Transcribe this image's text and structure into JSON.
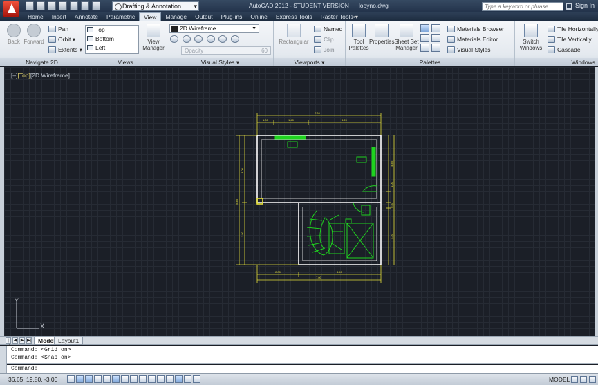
{
  "titlebar": {
    "app_title": "AutoCAD 2012 - STUDENT VERSION",
    "file_name": "looyno.dwg",
    "workspace": "Drafting & Annotation",
    "search_placeholder": "Type a keyword or phrase",
    "sign_in": "Sign In"
  },
  "ribbon_tabs": [
    "Home",
    "Insert",
    "Annotate",
    "Parametric",
    "View",
    "Manage",
    "Output",
    "Plug-ins",
    "Online",
    "Express Tools",
    "Raster Tools"
  ],
  "active_tab": "View",
  "ribbon": {
    "navigate": {
      "label": "Navigate 2D",
      "back": "Back",
      "forward": "Forward",
      "pan": "Pan",
      "orbit": "Orbit",
      "extents": "Extents"
    },
    "views": {
      "label": "Views",
      "items": [
        "Top",
        "Bottom",
        "Left"
      ],
      "view_manager": "View Manager"
    },
    "visual_styles": {
      "label": "Visual Styles",
      "current": "2D Wireframe",
      "opacity_label": "Opacity",
      "opacity_value": "60"
    },
    "viewports": {
      "label": "Viewports",
      "rectangular": "Rectangular",
      "named": "Named",
      "clip": "Clip",
      "join": "Join"
    },
    "palettes": {
      "label": "Palettes",
      "tool_palettes": "Tool Palettes",
      "properties": "Properties",
      "sheet_set_manager": "Sheet Set Manager",
      "materials_browser": "Materials Browser",
      "materials_editor": "Materials Editor",
      "visual_styles": "Visual Styles"
    },
    "windows": {
      "label": "Windows",
      "switch_windows": "Switch Windows",
      "tile_h": "Tile Horizontally",
      "tile_v": "Tile Vertically",
      "cascade": "Cascade"
    }
  },
  "viewport": {
    "control_minus": "[–]",
    "view": "[Top]",
    "style": "[2D Wireframe]"
  },
  "drawing": {
    "dims": {
      "top_total": "7.00",
      "top_parts": [
        "1.00",
        "1.40",
        "4.20"
      ],
      "bottom_total": "7.00",
      "bottom_parts": [
        "2.00",
        "4.40"
      ],
      "left": [
        "4.00",
        "5.40",
        "3.90"
      ],
      "right": [
        "4.40",
        "1.00",
        "0.40",
        "4.20"
      ]
    }
  },
  "ucs": {
    "x": "X",
    "y": "Y"
  },
  "layout_tabs": [
    "Model",
    "Layout1"
  ],
  "command_history": [
    "Command:  <Grid on>",
    "Command:  <Snap on>"
  ],
  "command_prompt": "Command:",
  "status": {
    "coords": "36.65, 19.80, -3.00",
    "model": "MODEL"
  },
  "colors": {
    "wall": "#ffffff",
    "dimension": "#e6e13b",
    "fixture": "#1fd31f",
    "grid": "#262b34"
  }
}
